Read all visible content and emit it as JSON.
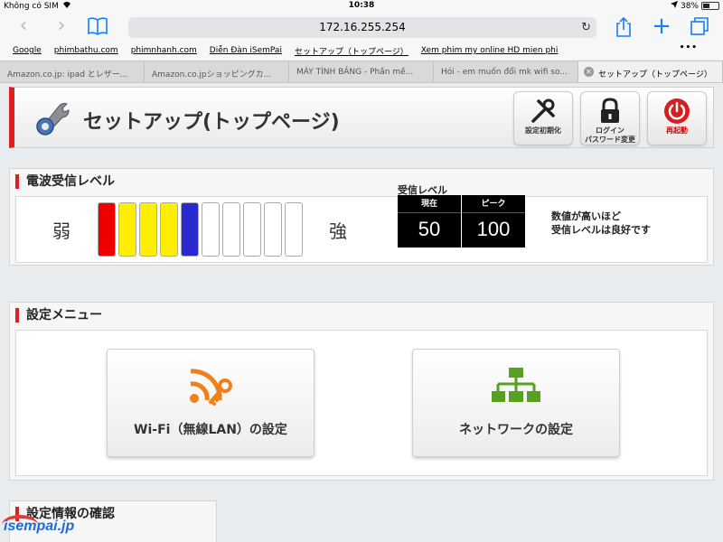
{
  "status": {
    "carrier": "Không có SIM",
    "time": "10:38",
    "battery": "38%"
  },
  "browser": {
    "url": "172.16.255.254",
    "bookmarks": [
      "Google",
      "phimbathu.com",
      "phimnhanh.com",
      "Diễn Đàn iSemPai",
      "セットアップ（トップページ）",
      "Xem phim my online HD mien phi"
    ],
    "tabs": [
      {
        "label": "Amazon.co.jp: ipad とレザー..."
      },
      {
        "label": "Amazon.co.jpショッピングカ..."
      },
      {
        "label": "MÁY TÍNH BẢNG - Phần mề..."
      },
      {
        "label": "Hỏi - em muốn đổi mk wifi so..."
      },
      {
        "label": "セットアップ（トップページ）"
      }
    ]
  },
  "header": {
    "title": "セットアップ(トップページ)",
    "buttons": {
      "reset": "設定初期化",
      "login_line1": "ログイン",
      "login_line2": "パスワード変更",
      "restart": "再起動"
    }
  },
  "signal": {
    "section_title": "電波受信レベル",
    "weak_label": "弱",
    "strong_label": "強",
    "bars": [
      "#ee0000",
      "#ffee00",
      "#ffee00",
      "#ffee00",
      "#2a2ad0",
      "#ffffff",
      "#ffffff",
      "#ffffff",
      "#ffffff",
      "#ffffff"
    ],
    "level_title": "受信レベル",
    "current_label": "現在",
    "peak_label": "ピーク",
    "current_value": "50",
    "peak_value": "100",
    "note_line1": "数値が高いほど",
    "note_line2": "受信レベルは良好です"
  },
  "settings_menu": {
    "section_title": "設定メニュー",
    "wifi_label": "Wi-Fi（無線LAN）の設定",
    "network_label": "ネットワークの設定"
  },
  "info": {
    "section_title": "設定情報の確認"
  },
  "watermark": "isempai.jp",
  "colors": {
    "accent_red": "#e02020",
    "wifi_orange": "#f0801a",
    "network_green": "#5aa020"
  }
}
